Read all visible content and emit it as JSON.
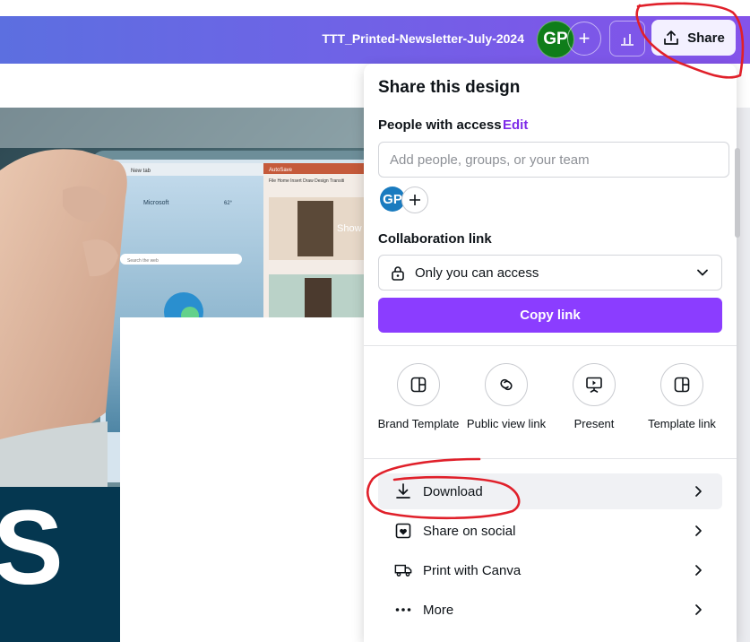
{
  "header": {
    "document_title": "TTT_Printed-Newsletter-July-2024",
    "avatar_initials": "GP",
    "add_collaborator": "+",
    "share_label": "Share"
  },
  "canvas": {
    "big_letter": "S",
    "tablet_screen_left_brand": "Microsoft",
    "tablet_search_placeholder": "Search the web",
    "tablet_screen_right_text": "Show",
    "tablet_tab_title": "New tab",
    "tablet_autosave": "AutoSave",
    "tablet_ribbon": "File  Home  Insert  Draw  Design  Transiti",
    "tablet_weather": "62°"
  },
  "share_panel": {
    "title": "Share this design",
    "people_access_label": "People with access",
    "edit_label": "Edit",
    "people_input_placeholder": "Add people, groups, or your team",
    "member_initials": "GP",
    "collab_link_label": "Collaboration link",
    "access_value": "Only you can access",
    "copy_link_label": "Copy link",
    "quick_options": [
      {
        "label": "Brand Template",
        "icon": "template-icon"
      },
      {
        "label": "Public view link",
        "icon": "link-icon"
      },
      {
        "label": "Present",
        "icon": "presentation-icon"
      },
      {
        "label": "Template link",
        "icon": "template-icon"
      }
    ],
    "menu": [
      {
        "label": "Download",
        "icon": "download-icon"
      },
      {
        "label": "Share on social",
        "icon": "heart-icon"
      },
      {
        "label": "Print with Canva",
        "icon": "truck-icon"
      },
      {
        "label": "More",
        "icon": "more-icon"
      }
    ]
  },
  "colors": {
    "accent": "#8b3dff",
    "edit_link": "#7d2ae8",
    "annotation": "#e0202a",
    "avatar_green": "#0f7d1a",
    "avatar_blue": "#1a7bbf",
    "navy": "#053750"
  }
}
